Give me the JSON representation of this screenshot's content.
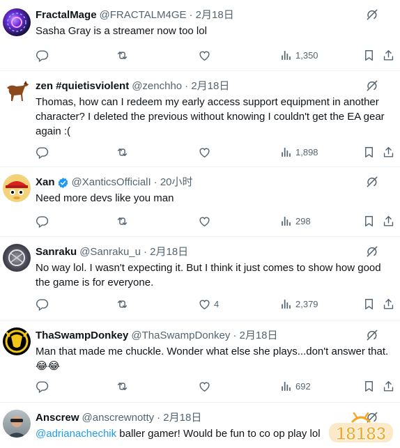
{
  "tweets": [
    {
      "name": "FractalMage",
      "handle": "@FRACTALM4GE",
      "time": "· 2月18日",
      "text": "Sasha Gray is a streamer now too lol",
      "views": "1,350"
    },
    {
      "name": "zen #quietisviolent",
      "handle": "@zenchho",
      "time": "· 2月18日",
      "text": "Thomas, how can I redeem my early access support equipment in another character? I deleted the previous without knowing I couldn't get the EA gear again :(",
      "views": "1,898"
    },
    {
      "name": "Xan",
      "handle": "@XanticsOfficialI",
      "time": "· 20小时",
      "text": "Need more devs like you man",
      "views": "298"
    },
    {
      "name": "Sanraku",
      "handle": "@Sanraku_u",
      "time": "· 2月18日",
      "text": "No way lol. I wasn't expecting it. But I think it just comes to show how good the game is for everyone.",
      "likes": "4",
      "views": "2,379"
    },
    {
      "name": "ThaSwampDonkey",
      "handle": "@ThaSwampDonkey",
      "time": "· 2月18日",
      "text": "Man that made me chuckle. Wonder what else she plays...don't answer that. 😂😂",
      "views": "692"
    },
    {
      "name": "Anscrew",
      "handle": "@anscrewnotty",
      "time": "· 2月18日",
      "mention": "@adrianachechik",
      "text": " baller gamer! Would be fun to co op play lol"
    }
  ],
  "watermark": "18183",
  "colors": {
    "muted": "#536471",
    "link": "#1d9bf0",
    "border": "#eff3f4"
  }
}
